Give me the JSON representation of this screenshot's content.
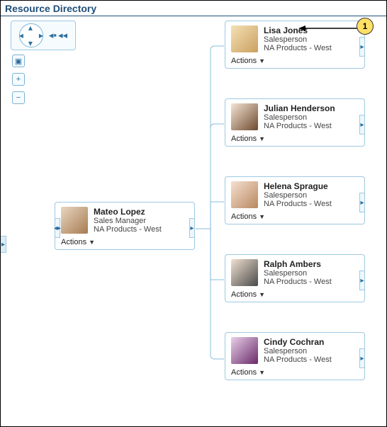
{
  "panel": {
    "title": "Resource Directory"
  },
  "actions_label": "Actions",
  "annotation": {
    "number": "1"
  },
  "manager": {
    "name": "Mateo Lopez",
    "role": "Sales Manager",
    "location": "NA Products -  West"
  },
  "reports": [
    {
      "name": "Lisa Jones",
      "role": "Salesperson",
      "location": "NA Products -  West"
    },
    {
      "name": "Julian Henderson",
      "role": "Salesperson",
      "location": "NA Products -  West"
    },
    {
      "name": "Helena Sprague",
      "role": "Salesperson",
      "location": "NA Products -  West"
    },
    {
      "name": "Ralph Ambers",
      "role": "Salesperson",
      "location": "NA Products -  West"
    },
    {
      "name": "Cindy Cochran",
      "role": "Salesperson",
      "location": "NA Products -  West"
    }
  ]
}
